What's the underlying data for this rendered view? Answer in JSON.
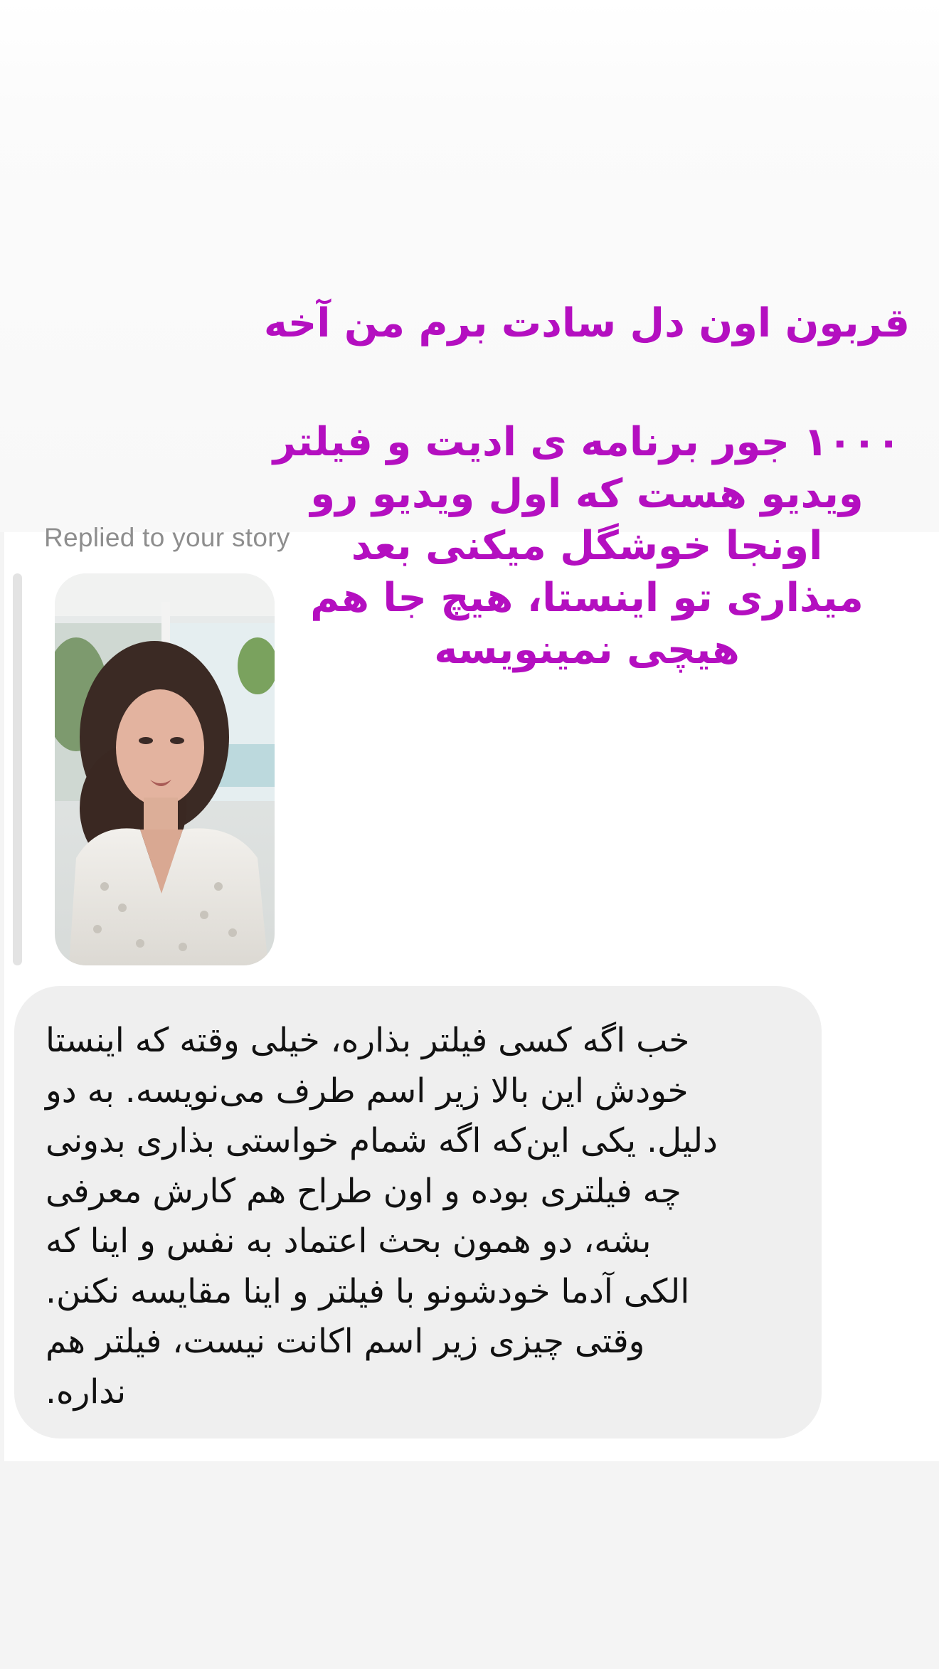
{
  "story_reply": {
    "label": "Replied to your story",
    "thumbnail_icon": "story-photo"
  },
  "story_overlay": {
    "color": "#b40fc0",
    "line_1": "قربون اون دل سادت برم من آخه",
    "body_lines": [
      "۱۰۰۰ جور برنامه ی ادیت و فیلتر",
      "ویدیو هست که اول ویدیو رو",
      "اونجا خوشگل میکنی بعد",
      "میذاری تو اینستا، هیچ جا هم",
      "هیچی نمینویسه"
    ]
  },
  "message": {
    "lines": [
      "خب اگه کسی فیلتر بذاره، خیلی وقته که اینستا",
      "خودش این بالا زیر اسم طرف می‌نویسه. به دو",
      "دلیل. یکی این‌که اگه شمام خواستی بذاری بدونی",
      "چه فیلتری بوده و اون طراح هم کارش معرفی",
      "بشه، دو همون بحث اعتماد به نفس و اینا که",
      "الکی آدما خودشونو با فیلتر و اینا مقایسه نکنن.",
      "وقتی چیزی زیر اسم اکانت نیست، فیلتر هم",
      "نداره."
    ]
  }
}
